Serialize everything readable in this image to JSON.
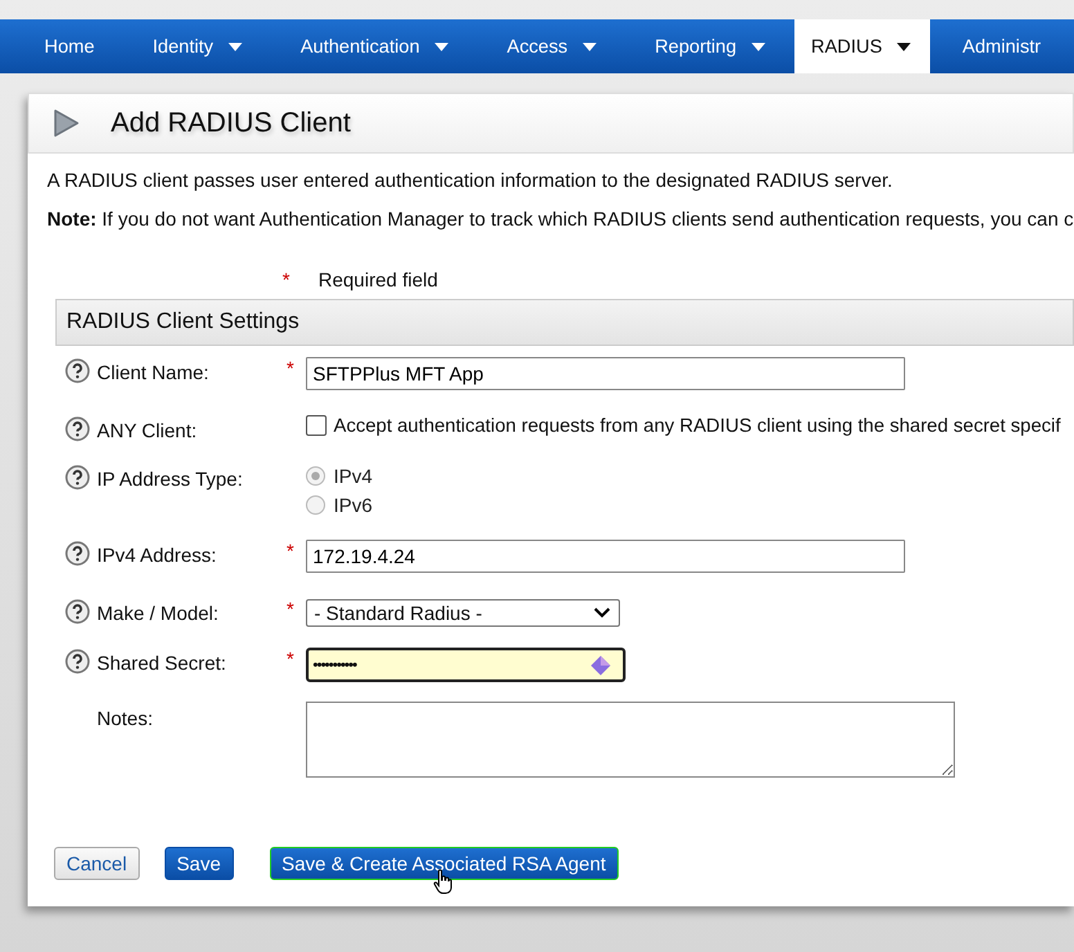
{
  "nav": [
    {
      "label": "Home",
      "dropdown": false,
      "selected": false
    },
    {
      "label": "Identity",
      "dropdown": true,
      "selected": false
    },
    {
      "label": "Authentication",
      "dropdown": true,
      "selected": false
    },
    {
      "label": "Access",
      "dropdown": true,
      "selected": false
    },
    {
      "label": "Reporting",
      "dropdown": true,
      "selected": false
    },
    {
      "label": "RADIUS",
      "dropdown": true,
      "selected": true
    },
    {
      "label": "Administr",
      "dropdown": false,
      "selected": false
    }
  ],
  "page_title": "Add RADIUS Client",
  "intro": "A RADIUS client passes user entered authentication information to the designated RADIUS server.",
  "note": "**Note:** If you do not want Authentication Manager to track which RADIUS clients send authentication requests, you can c",
  "required_marker": "*",
  "required_label": "Required field",
  "section_title": "RADIUS Client Settings",
  "fields": [
    {
      "kind": "text",
      "label": "Client Name:",
      "help": true,
      "required": true,
      "value": "SFTPPlus MFT App"
    },
    {
      "kind": "checkbox",
      "label": "ANY Client:",
      "help": true,
      "required": false,
      "checked": false,
      "text": "Accept authentication requests from any RADIUS client using the shared secret specif"
    },
    {
      "kind": "radio",
      "label": "IP Address Type:",
      "help": true,
      "required": false,
      "options": [
        {
          "label": "IPv4",
          "selected": true,
          "disabled": true
        },
        {
          "label": "IPv6",
          "selected": false,
          "disabled": true
        }
      ]
    },
    {
      "kind": "text",
      "label": "IPv4 Address:",
      "help": true,
      "required": true,
      "value": "172.19.4.24"
    },
    {
      "kind": "select",
      "label": "Make / Model:",
      "help": true,
      "required": true,
      "value": "- Standard Radius -"
    },
    {
      "kind": "password",
      "label": "Shared Secret:",
      "help": true,
      "required": true,
      "value": "•••••••••••",
      "focused": true
    },
    {
      "kind": "textarea",
      "label": "Notes:",
      "help": false,
      "required": false
    }
  ],
  "buttons": [
    {
      "label": "Cancel",
      "kind": "secondary"
    },
    {
      "label": "Save",
      "kind": "primary"
    },
    {
      "label": "Save & Create Associated RSA Agent",
      "kind": "primary-hover"
    }
  ]
}
